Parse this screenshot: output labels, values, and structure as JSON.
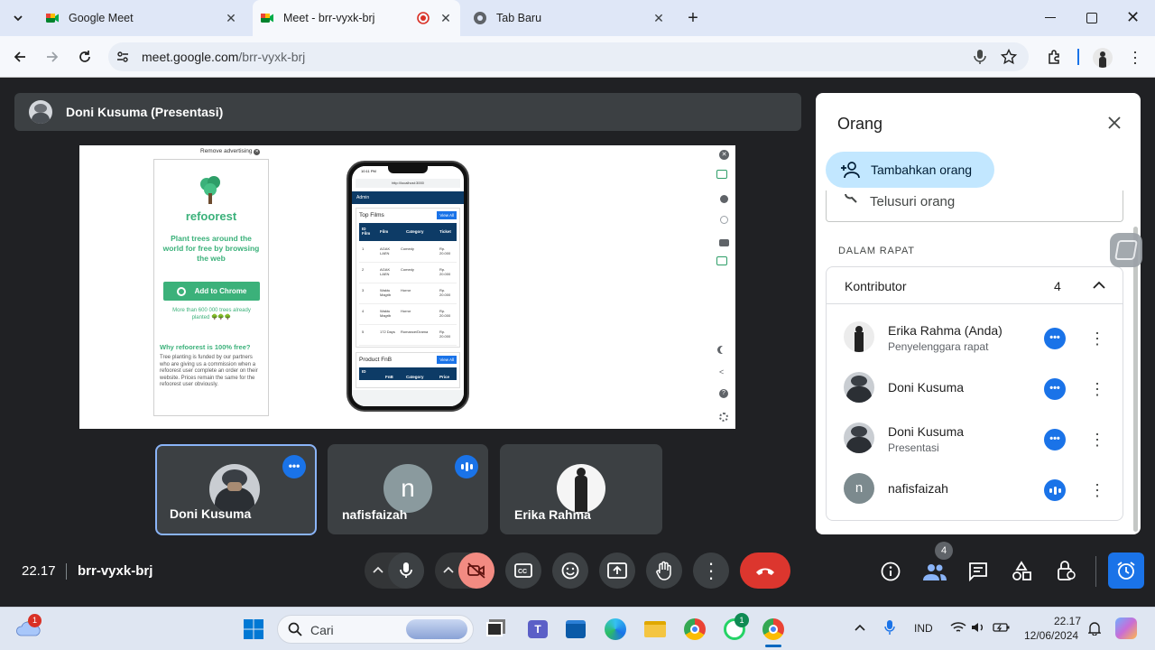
{
  "browser": {
    "tabs": [
      {
        "title": "Google Meet",
        "icon": "meet-icon"
      },
      {
        "title": "Meet - brr-vyxk-brj",
        "icon": "meet-icon",
        "recording": true
      },
      {
        "title": "Tab Baru",
        "icon": "chrome-icon"
      }
    ],
    "url_host": "meet.google.com",
    "url_path": "/brr-vyxk-brj"
  },
  "presentation": {
    "presenter_label": "Doni Kusuma (Presentasi)",
    "ad": {
      "remove_text": "Remove advertising",
      "brand": "refoorest",
      "headline": "Plant trees around the world for free by browsing the web",
      "cta": "Add to Chrome",
      "stats": "More than 600 000 trees already planted 🌳🌳🌳",
      "why_title": "Why refoorest is 100% free?",
      "why_body": "Tree planting is funded by our partners who are giving us a commission when a refoorest user complete an order on their website. Prices remain the same for the refoorest user obviously."
    },
    "phone": {
      "time": "10:11 PM",
      "url": "http://localhost:3000",
      "header": "Admin",
      "section1": "Top Films",
      "view_all": "View All",
      "columns": [
        "ID Film",
        "Film",
        "Category",
        "Ticket"
      ],
      "rows": [
        [
          "1",
          "AGAK LAEN",
          "Comedy",
          "Rp. 20.000"
        ],
        [
          "2",
          "AGAK LAEN",
          "Comedy",
          "Rp. 20.000"
        ],
        [
          "3",
          "Waktu Magrib",
          "Horror",
          "Rp. 20.000"
        ],
        [
          "4",
          "Waktu Magrib",
          "Horror",
          "Rp. 20.000"
        ],
        [
          "5",
          "172 Days",
          "Romance/Drama",
          "Rp. 20.000"
        ]
      ],
      "section2": "Product FnB",
      "columns2": [
        "ID",
        "FnB",
        "Category",
        "Price"
      ]
    }
  },
  "tiles": [
    {
      "name": "Doni Kusuma",
      "avatar": "photo",
      "active": true,
      "badge": "•••"
    },
    {
      "name": "nafisfaizah",
      "avatar_letter": "n",
      "active": false,
      "badge": "audio"
    },
    {
      "name": "Erika Rahma",
      "avatar": "photo",
      "active": false
    }
  ],
  "bottombar": {
    "time": "22.17",
    "meeting_code": "brr-vyxk-brj",
    "people_count": "4"
  },
  "panel": {
    "title": "Orang",
    "add_button": "Tambahkan orang",
    "search_placeholder": "Telusuri orang",
    "section_label": "DALAM RAPAT",
    "group_label": "Kontributor",
    "group_count": "4",
    "people": [
      {
        "name": "Erika Rahma (Anda)",
        "sub": "Penyelenggara rapat",
        "avatar": "photo"
      },
      {
        "name": "Doni Kusuma",
        "sub": "",
        "avatar": "photo"
      },
      {
        "name": "Doni Kusuma",
        "sub": "Presentasi",
        "avatar": "photo"
      },
      {
        "name": "nafisfaizah",
        "sub": "",
        "avatar_letter": "n"
      }
    ]
  },
  "taskbar": {
    "search_label": "Cari",
    "lang": "IND",
    "clock_time": "22.17",
    "clock_date": "12/06/2024",
    "weather_badge": "1",
    "whatsapp_badge": "1"
  },
  "colors": {
    "accent": "#1a73e8",
    "danger": "#ea4335",
    "green": "#2e7d32",
    "refoorest_green": "#3bb17a"
  }
}
